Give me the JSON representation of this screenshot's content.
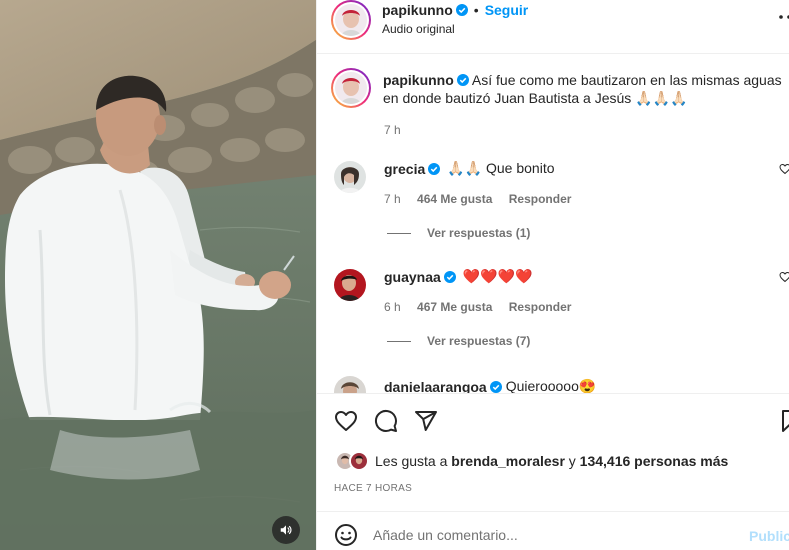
{
  "post": {
    "author": "papikunno",
    "follow_label": "Seguir",
    "separator": "•",
    "audio": "Audio original",
    "more_icon": "more-horizontal-icon"
  },
  "caption": {
    "username": "papikunno",
    "text": "Así fue como me bautizaron en las mismas aguas en donde bautizó Juan Bautista a Jesús 🙏🏻🙏🏻🙏🏻",
    "time": "7 h"
  },
  "comments": [
    {
      "username": "grecia",
      "text": "🙏🏻🙏🏻 Que bonito",
      "time": "7 h",
      "likes": "464 Me gusta",
      "reply_label": "Responder",
      "replies_label": "Ver respuestas (1)"
    },
    {
      "username": "guaynaa",
      "text": "❤️❤️❤️❤️",
      "time": "6 h",
      "likes": "467 Me gusta",
      "reply_label": "Responder",
      "replies_label": "Ver respuestas (7)"
    },
    {
      "username": "danielaarangoa",
      "text": "Quierooooo😍"
    }
  ],
  "actions": {
    "like_icon": "heart-icon",
    "comment_icon": "comment-icon",
    "share_icon": "send-icon",
    "save_icon": "bookmark-icon"
  },
  "likes": {
    "prefix": "Les gusta a",
    "user": "brenda_moralesr",
    "middle": "y",
    "count": "134,416 personas más"
  },
  "time_ago": "HACE 7 HORAS",
  "add_comment": {
    "placeholder": "Añade un comentario...",
    "publish_label": "Publicar"
  },
  "colors": {
    "accent": "#0095f6",
    "verified": "#0095f6",
    "text": "#262626",
    "muted": "#737373",
    "heart": "#ed4956"
  }
}
